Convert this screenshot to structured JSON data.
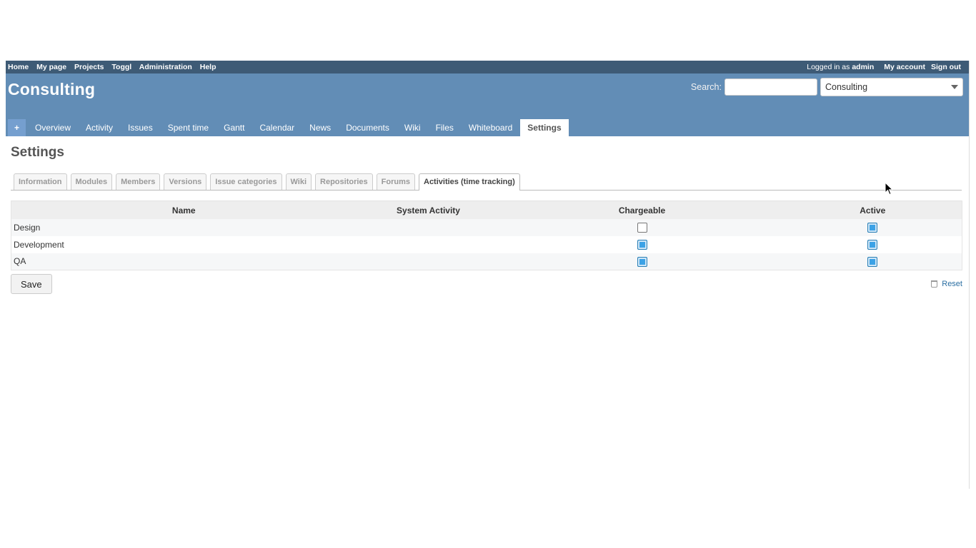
{
  "top_menu": {
    "items": [
      "Home",
      "My page",
      "Projects",
      "Toggl",
      "Administration",
      "Help"
    ],
    "logged_prefix": "Logged in as",
    "user": "admin",
    "my_account": "My account",
    "sign_out": "Sign out"
  },
  "header": {
    "title": "Consulting",
    "search_label": "Search:",
    "search_value": "",
    "project_jump": "Consulting"
  },
  "main_menu": {
    "new_object": "+",
    "tabs": [
      "Overview",
      "Activity",
      "Issues",
      "Spent time",
      "Gantt",
      "Calendar",
      "News",
      "Documents",
      "Wiki",
      "Files",
      "Whiteboard",
      "Settings"
    ],
    "selected": "Settings"
  },
  "page": {
    "title": "Settings",
    "tabs": [
      "Information",
      "Modules",
      "Members",
      "Versions",
      "Issue categories",
      "Wiki",
      "Repositories",
      "Forums",
      "Activities (time tracking)"
    ],
    "selected_tab": "Activities (time tracking)"
  },
  "table": {
    "headers": [
      "Name",
      "System Activity",
      "Chargeable",
      "Active"
    ],
    "rows": [
      {
        "name": "Design",
        "system_activity": "",
        "chargeable": false,
        "active": true
      },
      {
        "name": "Development",
        "system_activity": "",
        "chargeable": true,
        "active": true
      },
      {
        "name": "QA",
        "system_activity": "",
        "chargeable": true,
        "active": true
      }
    ]
  },
  "actions": {
    "save": "Save",
    "reset": "Reset"
  },
  "colors": {
    "top_menu_bg": "#3e5b76",
    "header_bg": "#628db6",
    "checkbox_on": "#3ca2e6"
  }
}
